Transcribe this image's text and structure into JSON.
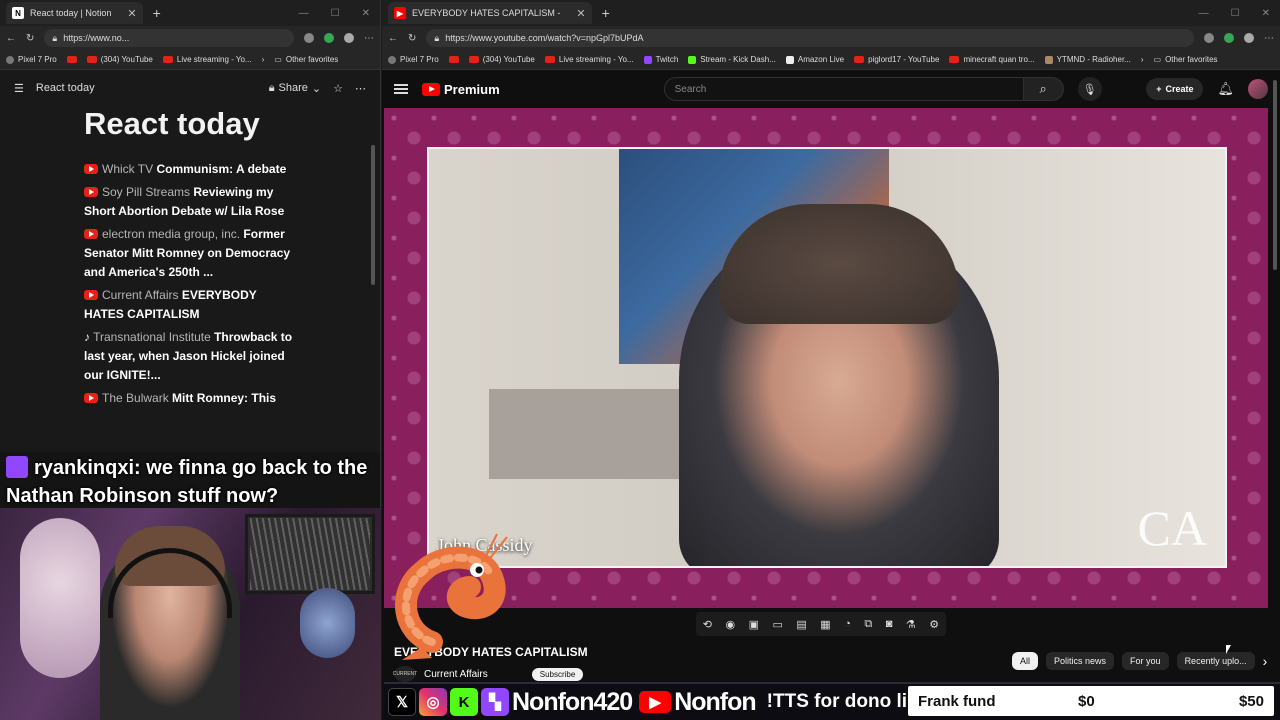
{
  "left_browser": {
    "tab_title": "React today | Notion",
    "url": "https://www.no...",
    "favorites": [
      "Pixel 7 Pro",
      "(304) YouTube",
      "Live streaming - Yo...",
      "Other favorites"
    ]
  },
  "notion": {
    "breadcrumb": "React today",
    "share_label": "Share",
    "title": "React today",
    "items": [
      {
        "channel": "Whick TV",
        "title": "Communism: A debate"
      },
      {
        "channel": "Soy Pill Streams",
        "title": "Reviewing my Short Abortion Debate w/  Lila Rose"
      },
      {
        "channel": "electron media group, inc.",
        "title": "Former Senator Mitt Romney on Democracy and America's 250th ..."
      },
      {
        "channel": "Current Affairs",
        "title": "EVERYBODY HATES CAPITALISM"
      },
      {
        "channel": "Transnational Institute",
        "title": "Throwback to last year, when Jason Hickel joined our IGNITE!..."
      },
      {
        "channel": "The Bulwark",
        "title": "Mitt Romney: This"
      }
    ]
  },
  "chat": {
    "username": "ryankinqxi:",
    "message": "we finna go back to the Nathan Robinson stuff now?"
  },
  "right_browser": {
    "tab_title": "EVERYBODY HATES CAPITALISM -",
    "url": "https://www.youtube.com/watch?v=npGpl7bUPdA",
    "favorites": [
      "Pixel 7 Pro",
      "(304) YouTube",
      "Live streaming - Yo...",
      "Twitch",
      "Stream - Kick Dash...",
      "Amazon Live",
      "piglord17 - YouTube",
      "minecraft quan tro...",
      "YTMND - Radioher...",
      "Other favorites"
    ]
  },
  "youtube": {
    "brand": "Premium",
    "search_placeholder": "Search",
    "create_label": "Create",
    "video_speaker": "John Cassidy",
    "video_logo": "CA",
    "video_title": "EVERYBODY HATES CAPITALISM",
    "channel_name": "Current Affairs",
    "subscribe_label": "Subscribe",
    "chips": [
      "All",
      "Politics news",
      "For you",
      "Recently uplo..."
    ]
  },
  "stream_bar": {
    "handle_1": "Nonfon420",
    "handle_2": "Nonfon",
    "tts_text": "!TTS for dono link",
    "fund_name": "Frank fund",
    "fund_current": "$0",
    "fund_goal": "$50"
  },
  "colors": {
    "youtube_red": "#ff0000",
    "twitch_purple": "#9146ff",
    "kick_green": "#53fc18",
    "player_bg": "#8a1f5e"
  }
}
